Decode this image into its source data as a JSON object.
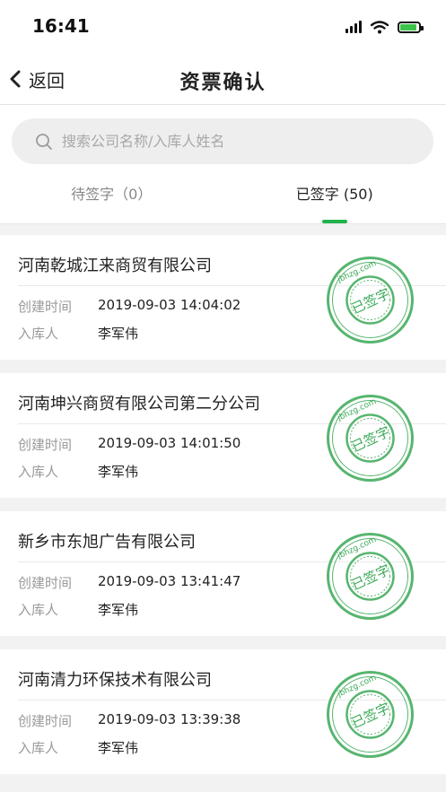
{
  "status": {
    "time": "16:41"
  },
  "nav": {
    "back_label": "返回",
    "title": "资票确认"
  },
  "search": {
    "placeholder": "搜索公司名称/入库人姓名",
    "value": ""
  },
  "tabs": [
    {
      "label": "待签字（0）",
      "active": false
    },
    {
      "label": "已签字 (50)",
      "active": true
    }
  ],
  "labels": {
    "created_time": "创建时间",
    "stocker": "入库人"
  },
  "stamp": {
    "text": "已签字",
    "site": "jbhzg.com"
  },
  "colors": {
    "accent": "#21b24b",
    "stamp": "#3aa956"
  },
  "records": [
    {
      "company": "河南乾城江来商贸有限公司",
      "created": "2019-09-03 14:04:02",
      "stocker": "李军伟"
    },
    {
      "company": "河南坤兴商贸有限公司第二分公司",
      "created": "2019-09-03 14:01:50",
      "stocker": "李军伟"
    },
    {
      "company": "新乡市东旭广告有限公司",
      "created": "2019-09-03 13:41:47",
      "stocker": "李军伟"
    },
    {
      "company": "河南清力环保技术有限公司",
      "created": "2019-09-03 13:39:38",
      "stocker": "李军伟"
    }
  ]
}
